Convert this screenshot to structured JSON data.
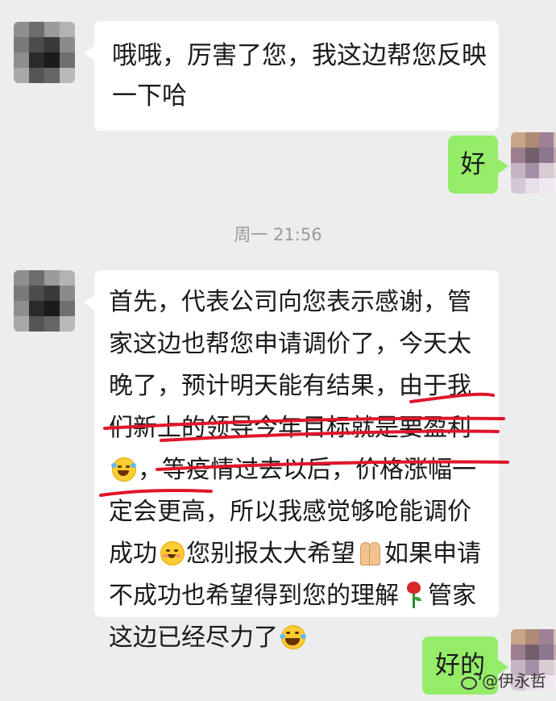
{
  "conversation": {
    "messages": [
      {
        "side": "incoming",
        "lines": [
          "哦哦，厉害了您，我这边帮您反映",
          "一下哈"
        ]
      },
      {
        "side": "outgoing",
        "text": "好"
      },
      {
        "side": "incoming",
        "lines": [
          "首先，代表公司向您表示感谢，管",
          "家这边也帮您申请调价了，今天太",
          "晚了，预计明天能有结果，由于我",
          "们新上的领导今年目标就是要盈利",
          "，等疫情过去以后，价格涨幅一",
          "定会更高，所以我感觉够呛能调价",
          "成功",
          "您别报太大希望",
          "如果申请",
          "不成功也希望得到您的理解",
          "管家",
          "这边已经尽力了"
        ]
      },
      {
        "side": "outgoing",
        "text": "好的"
      }
    ],
    "timestamp": "周一 21:56"
  },
  "emojis": [
    "crying-laughing",
    "shy-smile",
    "folded-hands",
    "rose",
    "tears-of-joy"
  ],
  "watermark": {
    "text": "@伊永哲"
  },
  "colors": {
    "background": "#ededed",
    "incoming_bubble": "#ffffff",
    "outgoing_bubble": "#95ec69",
    "annotation": "#e0162b"
  }
}
